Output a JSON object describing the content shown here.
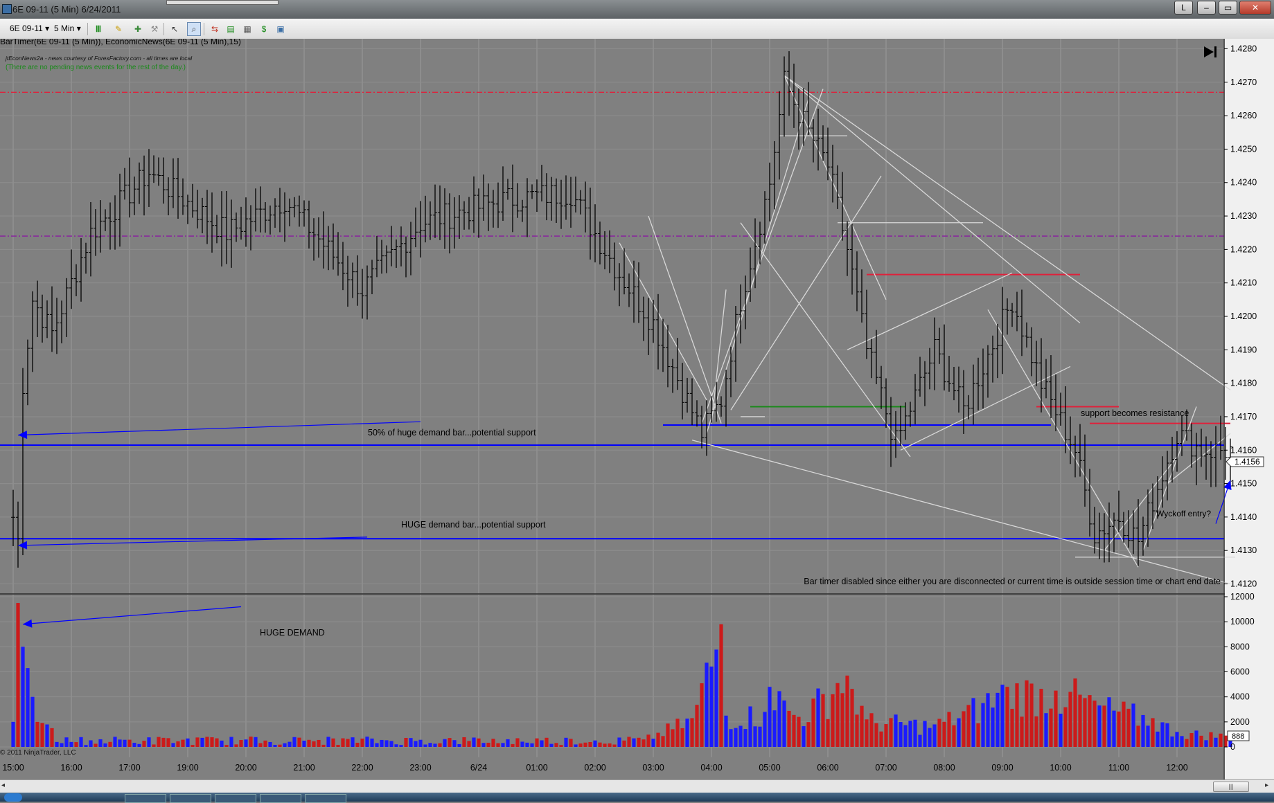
{
  "window": {
    "title": "6E 09-11 (5 Min)  6/24/2011",
    "buttons": [
      "L",
      "–",
      "▭",
      "✕"
    ]
  },
  "toolbar": {
    "instrument": "6E 09-11",
    "interval": "5 Min"
  },
  "indicator_header": {
    "line1": "BarTimer(6E 09-11 (5 Min)), EconomicNews(6E 09-11 (5 Min),15)",
    "line2": "jtEconNews2a - news courtesy of ForexFactory.com - all times are local",
    "line3": "(There are no pending news events for the rest of the day.)"
  },
  "annotations": {
    "half_demand": "50% of huge demand bar...potential support",
    "huge_demand_bar": "HUGE demand bar...potential support",
    "huge_demand": "HUGE DEMAND",
    "support_resistance": "support becomes resistance",
    "wyckoff": "Wyckoff entry?",
    "bar_timer": "Bar timer disabled since either you are disconnected or current time is outside session time or chart end date",
    "copyright": "© 2011 NinjaTrader, LLC"
  },
  "price_panel": {
    "last_price": "1.4156",
    "volume_marker": "888"
  },
  "colors": {
    "panel_bg": "#808080",
    "bar": "#000000",
    "blue_line": "#0000ff",
    "red_line": "#e0203a",
    "green_line": "#1a8a1a",
    "purple_dash": "#8a1aa0",
    "trendline": "#d8d8d8",
    "vol_up": "#1a1aff",
    "vol_down": "#cc1a1a"
  },
  "chart_data": {
    "type": "candlestick-ohlc",
    "y_ticks": [
      "1.4280",
      "1.4270",
      "1.4260",
      "1.4250",
      "1.4240",
      "1.4230",
      "1.4220",
      "1.4210",
      "1.4200",
      "1.4190",
      "1.4180",
      "1.4170",
      "1.4160",
      "1.4150",
      "1.4140",
      "1.4130",
      "1.4120"
    ],
    "ylim": [
      1.4117,
      1.4283
    ],
    "vol_ticks": [
      "12000",
      "10000",
      "8000",
      "6000",
      "4000",
      "2000",
      "0"
    ],
    "vol_ylim": [
      0,
      12000
    ],
    "time_labels": [
      "15:00",
      "16:00",
      "17:00",
      "19:00",
      "20:00",
      "21:00",
      "22:00",
      "23:00",
      "6/24",
      "01:00",
      "02:00",
      "03:00",
      "04:00",
      "05:00",
      "06:00",
      "07:00",
      "08:00",
      "09:00",
      "10:00",
      "11:00",
      "12:00"
    ],
    "time_label_slots": [
      0,
      12,
      24,
      36,
      48,
      60,
      72,
      84,
      96,
      108,
      120,
      132,
      144,
      156,
      168,
      180,
      192,
      204,
      216,
      228,
      240
    ],
    "bar_count": 252,
    "key_closes": [
      [
        0,
        1.414
      ],
      [
        1,
        1.4133
      ],
      [
        2,
        1.418
      ],
      [
        4,
        1.4205
      ],
      [
        8,
        1.4195
      ],
      [
        16,
        1.4225
      ],
      [
        28,
        1.4243
      ],
      [
        44,
        1.4225
      ],
      [
        56,
        1.4235
      ],
      [
        72,
        1.4208
      ],
      [
        84,
        1.4228
      ],
      [
        102,
        1.4235
      ],
      [
        115,
        1.4237
      ],
      [
        124,
        1.4215
      ],
      [
        132,
        1.4198
      ],
      [
        142,
        1.4165
      ],
      [
        146,
        1.4175
      ],
      [
        150,
        1.4205
      ],
      [
        156,
        1.424
      ],
      [
        159,
        1.427
      ],
      [
        164,
        1.4255
      ],
      [
        168,
        1.4245
      ],
      [
        172,
        1.422
      ],
      [
        176,
        1.419
      ],
      [
        182,
        1.4162
      ],
      [
        190,
        1.419
      ],
      [
        196,
        1.4172
      ],
      [
        206,
        1.4205
      ],
      [
        212,
        1.418
      ],
      [
        219,
        1.416
      ],
      [
        223,
        1.4135
      ],
      [
        228,
        1.414
      ],
      [
        232,
        1.4133
      ],
      [
        240,
        1.4165
      ],
      [
        245,
        1.416
      ],
      [
        251,
        1.416
      ]
    ],
    "volume_profile": [
      [
        0,
        2000
      ],
      [
        1,
        11500
      ],
      [
        2,
        8000
      ],
      [
        3,
        6300
      ],
      [
        4,
        4000
      ],
      [
        5,
        2000
      ],
      [
        8,
        1500
      ],
      [
        20,
        400
      ],
      [
        60,
        500
      ],
      [
        100,
        300
      ],
      [
        130,
        600
      ],
      [
        140,
        2300
      ],
      [
        146,
        9800
      ],
      [
        147,
        2500
      ],
      [
        155,
        2800
      ],
      [
        156,
        4800
      ],
      [
        162,
        2400
      ],
      [
        170,
        5100
      ],
      [
        172,
        5700
      ],
      [
        176,
        2200
      ],
      [
        190,
        1800
      ],
      [
        200,
        3500
      ],
      [
        205,
        4800
      ],
      [
        215,
        4500
      ],
      [
        218,
        4400
      ],
      [
        225,
        3300
      ],
      [
        235,
        2300
      ],
      [
        240,
        1200
      ],
      [
        251,
        900
      ]
    ],
    "horizontal_lines": [
      {
        "price": 1.4267,
        "style": "dashdot",
        "color": "red_line"
      },
      {
        "price": 1.4224,
        "style": "dashdot",
        "color": "purple_dash"
      },
      {
        "price": 1.41615,
        "style": "solid",
        "color": "blue_line"
      },
      {
        "price": 1.41335,
        "style": "solid",
        "color": "blue_line"
      }
    ]
  }
}
